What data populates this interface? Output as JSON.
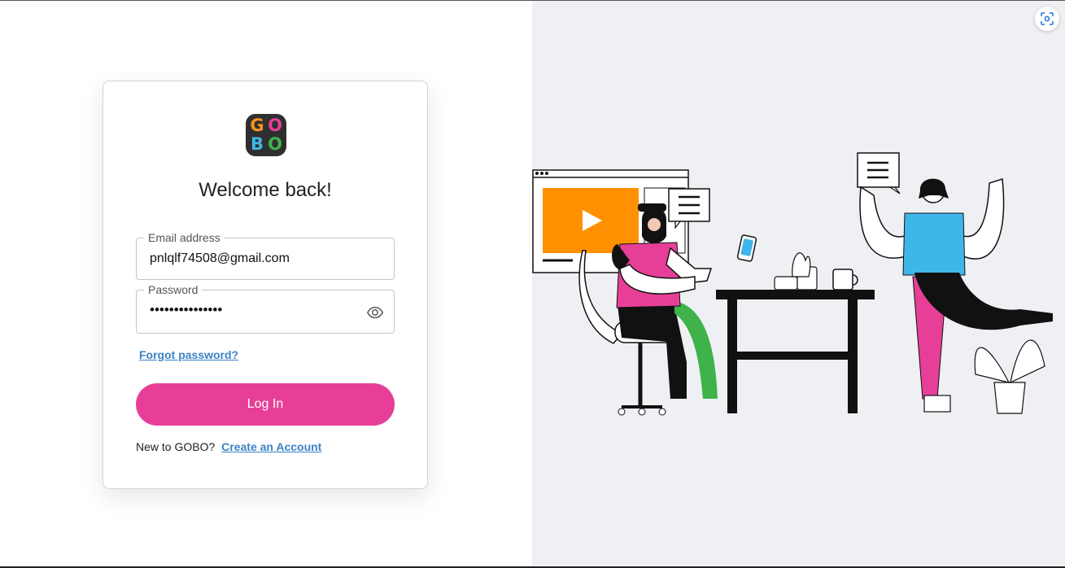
{
  "logo": {
    "letters": [
      "G",
      "O",
      "B",
      "O"
    ],
    "colors": [
      "#f7941d",
      "#e73f97",
      "#3fb6e8",
      "#3fb34a"
    ]
  },
  "login": {
    "heading": "Welcome back!",
    "email_label": "Email address",
    "email_value": "pnlqlf74508@gmail.com",
    "password_label": "Password",
    "password_value": "•••••••••••••••",
    "forgot_link": "Forgot password?",
    "submit_label": "Log In",
    "signup_prompt": "New to GOBO?",
    "signup_link": "Create an Account"
  },
  "icons": {
    "password_toggle": "eye-icon",
    "scan": "screenshot-scan-icon"
  },
  "colors": {
    "accent": "#e73f97",
    "link": "#3b82c4",
    "panel_bg": "#eff0f4"
  }
}
